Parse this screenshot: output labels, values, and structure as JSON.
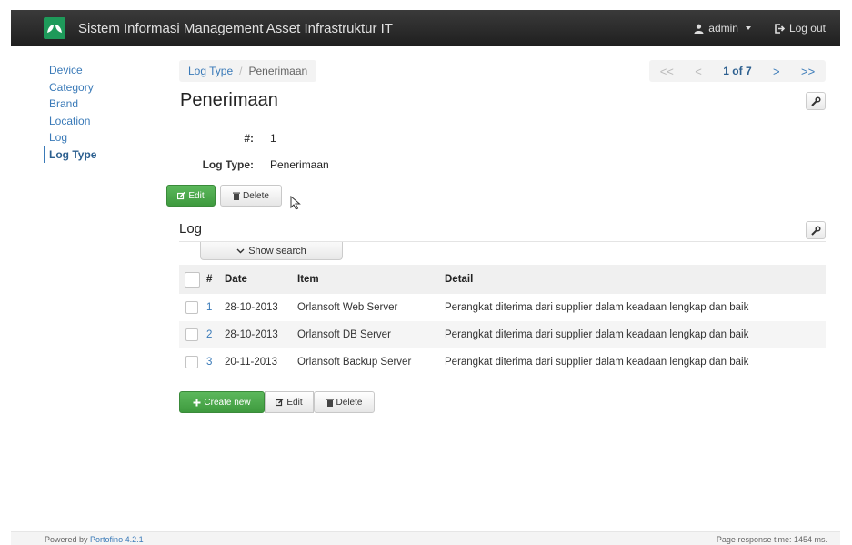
{
  "app": {
    "title": "Sistem Informasi Management Asset Infrastruktur IT"
  },
  "navbar": {
    "user": "admin",
    "logout": "Log out"
  },
  "sidebar": {
    "items": [
      {
        "label": "Device"
      },
      {
        "label": "Category"
      },
      {
        "label": "Brand"
      },
      {
        "label": "Location"
      },
      {
        "label": "Log"
      },
      {
        "label": "Log Type"
      }
    ]
  },
  "breadcrumb": {
    "parent": "Log Type",
    "separator": "/",
    "current": "Penerimaan"
  },
  "pager": {
    "first": "<<",
    "prev": "<",
    "count": "1 of 7",
    "next": ">",
    "last": ">>"
  },
  "page": {
    "title": "Penerimaan"
  },
  "fields": [
    {
      "label": "#:",
      "value": "1"
    },
    {
      "label": "Log Type:",
      "value": "Penerimaan"
    }
  ],
  "actions": {
    "edit": "Edit",
    "delete": "Delete"
  },
  "log_section": {
    "title": "Log",
    "show_search": "Show search",
    "columns": {
      "num": "#",
      "date": "Date",
      "item": "Item",
      "detail": "Detail"
    },
    "rows": [
      {
        "num": "1",
        "date": "28-10-2013",
        "item": "Orlansoft Web Server",
        "detail": "Perangkat diterima dari supplier dalam keadaan lengkap dan baik"
      },
      {
        "num": "2",
        "date": "28-10-2013",
        "item": "Orlansoft DB Server",
        "detail": "Perangkat diterima dari supplier dalam keadaan lengkap dan baik"
      },
      {
        "num": "3",
        "date": "20-11-2013",
        "item": "Orlansoft Backup Server",
        "detail": "Perangkat diterima dari supplier dalam keadaan lengkap dan baik"
      }
    ],
    "buttons": {
      "create": "Create new",
      "edit": "Edit",
      "delete": "Delete"
    }
  },
  "footer": {
    "powered_prefix": "Powered by",
    "powered_link": "Portofino 4.2.1",
    "response": "Page response time: 1454 ms."
  },
  "colors": {
    "navbar": "#2a2a2a",
    "link": "#3a7ab8",
    "success": "#4cae4c",
    "brand_logo": "#1e9a5a"
  }
}
